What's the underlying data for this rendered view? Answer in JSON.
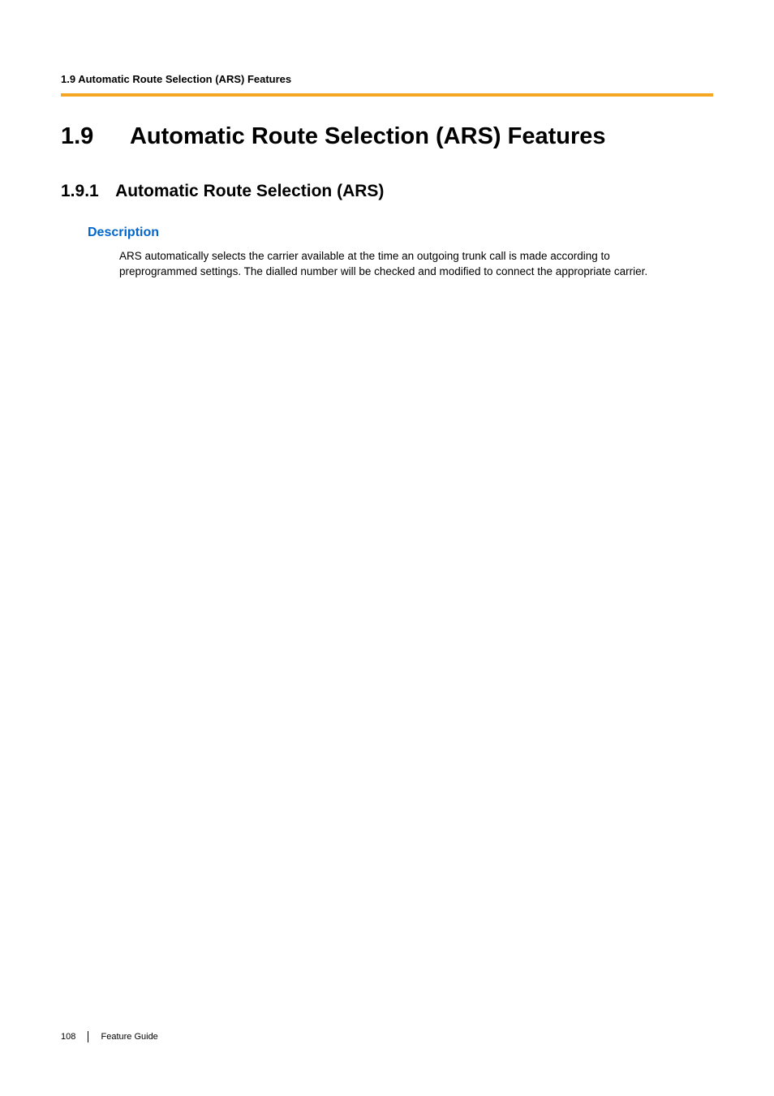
{
  "header": {
    "running_title": "1.9 Automatic Route Selection (ARS) Features"
  },
  "section": {
    "number": "1.9",
    "title": "Automatic Route Selection (ARS) Features"
  },
  "subsection": {
    "number": "1.9.1",
    "title": "Automatic Route Selection (ARS)"
  },
  "description": {
    "heading": "Description",
    "body": "ARS automatically selects the carrier available at the time an outgoing trunk call is made according to preprogrammed settings. The dialled number will be checked and modified to connect the appropriate carrier."
  },
  "footer": {
    "page_number": "108",
    "label": "Feature Guide"
  }
}
